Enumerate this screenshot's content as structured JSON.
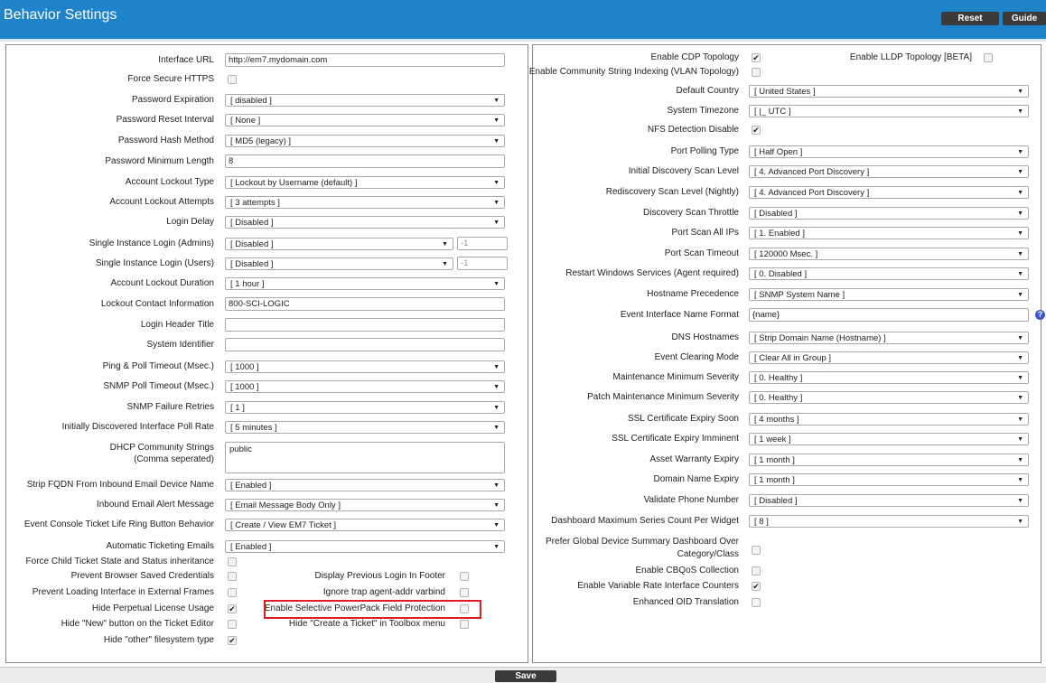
{
  "header": {
    "title": "Behavior Settings",
    "reset_label": "Reset",
    "guide_label": "Guide"
  },
  "left": {
    "interface_url": {
      "label": "Interface URL",
      "value": "http://em7.mydomain.com"
    },
    "force_secure_https": {
      "label": "Force Secure HTTPS"
    },
    "password_expiration": {
      "label": "Password Expiration",
      "value": "[ disabled ]"
    },
    "password_reset_interval": {
      "label": "Password Reset Interval",
      "value": "[ None ]"
    },
    "password_hash_method": {
      "label": "Password Hash Method",
      "value": "[ MD5 (legacy) ]"
    },
    "password_min_length": {
      "label": "Password Minimum Length",
      "value": "8"
    },
    "account_lockout_type": {
      "label": "Account Lockout Type",
      "value": "[ Lockout by Username (default) ]"
    },
    "account_lockout_attempts": {
      "label": "Account Lockout Attempts",
      "value": "[ 3 attempts ]"
    },
    "login_delay": {
      "label": "Login Delay",
      "value": "[ Disabled ]"
    },
    "single_login_admins": {
      "label": "Single Instance Login (Admins)",
      "value": "[ Disabled ]",
      "extra": "-1"
    },
    "single_login_users": {
      "label": "Single Instance Login (Users)",
      "value": "[ Disabled ]",
      "extra": "-1"
    },
    "account_lockout_duration": {
      "label": "Account Lockout Duration",
      "value": "[ 1 hour ]"
    },
    "lockout_contact": {
      "label": "Lockout Contact Information",
      "value": "800-SCI-LOGIC"
    },
    "login_header_title": {
      "label": "Login Header Title",
      "value": ""
    },
    "system_identifier": {
      "label": "System Identifier",
      "value": ""
    },
    "ping_poll_timeout": {
      "label": "Ping & Poll Timeout (Msec.)",
      "value": "[ 1000 ]"
    },
    "snmp_poll_timeout": {
      "label": "SNMP Poll Timeout (Msec.)",
      "value": "[ 1000 ]"
    },
    "snmp_failure_retries": {
      "label": "SNMP Failure Retries",
      "value": "[ 1 ]"
    },
    "interface_poll_rate": {
      "label": "Initially Discovered Interface Poll Rate",
      "value": "[ 5 minutes ]"
    },
    "dhcp_strings": {
      "label": "DHCP Community Strings",
      "label2": "(Comma seperated)",
      "value": "public"
    },
    "strip_fqdn": {
      "label": "Strip FQDN From Inbound Email Device Name",
      "value": "[ Enabled ]"
    },
    "inbound_email_msg": {
      "label": "Inbound Email Alert Message",
      "value": "[ Email Message Body Only ]"
    },
    "event_console_ring": {
      "label": "Event Console Ticket Life Ring Button Behavior",
      "value": "[ Create / View EM7 Ticket ]"
    },
    "auto_ticket_emails": {
      "label": "Automatic Ticketing Emails",
      "value": "[ Enabled ]"
    },
    "force_child_ticket": {
      "label": "Force Child Ticket State and Status inheritance"
    },
    "prevent_browser_creds": {
      "label": "Prevent Browser Saved Credentials"
    },
    "prevent_external_frames": {
      "label": "Prevent Loading Interface in External Frames"
    },
    "hide_perpetual": {
      "label": "Hide Perpetual License Usage"
    },
    "hide_new_button": {
      "label": "Hide \"New\" button on the Ticket Editor"
    },
    "hide_other_fs": {
      "label": "Hide \"other\" filesystem type"
    },
    "display_prev_login": {
      "label": "Display Previous Login In Footer"
    },
    "ignore_trap": {
      "label": "Ignore trap agent-addr varbind"
    },
    "selective_powerpack": {
      "label": "Enable Selective PowerPack Field Protection"
    },
    "hide_create_ticket": {
      "label": "Hide \"Create a Ticket\" in Toolbox menu"
    }
  },
  "right": {
    "cdp": {
      "label": "Enable CDP Topology"
    },
    "lldp": {
      "label": "Enable LLDP Topology [BETA]"
    },
    "community_indexing": {
      "label": "Enable Community String Indexing (VLAN Topology)"
    },
    "default_country": {
      "label": "Default Country",
      "value": "[ United States ]"
    },
    "system_timezone": {
      "label": "System Timezone",
      "value": "[ |_ UTC ]"
    },
    "nfs_detection": {
      "label": "NFS Detection Disable"
    },
    "port_polling_type": {
      "label": "Port Polling Type",
      "value": "[ Half Open ]"
    },
    "initial_scan_level": {
      "label": "Initial Discovery Scan Level",
      "value": "[ 4. Advanced Port Discovery ]"
    },
    "rediscovery_scan_level": {
      "label": "Rediscovery Scan Level (Nightly)",
      "value": "[ 4. Advanced Port Discovery ]"
    },
    "scan_throttle": {
      "label": "Discovery Scan Throttle",
      "value": "[ Disabled ]"
    },
    "port_scan_all": {
      "label": "Port Scan All IPs",
      "value": "[ 1. Enabled ]"
    },
    "port_scan_timeout": {
      "label": "Port Scan Timeout",
      "value": "[ 120000 Msec. ]"
    },
    "restart_windows": {
      "label": "Restart Windows Services (Agent required)",
      "value": "[ 0. Disabled ]"
    },
    "hostname_precedence": {
      "label": "Hostname Precedence",
      "value": "[ SNMP System Name ]"
    },
    "event_iface_format": {
      "label": "Event Interface Name Format",
      "value": "{name}"
    },
    "dns_hostnames": {
      "label": "DNS Hostnames",
      "value": "[ Strip Domain Name (Hostname) ]"
    },
    "event_clearing": {
      "label": "Event Clearing Mode",
      "value": "[ Clear All in Group ]"
    },
    "maint_min_sev": {
      "label": "Maintenance Minimum Severity",
      "value": "[ 0. Healthy ]"
    },
    "patch_maint_min_sev": {
      "label": "Patch Maintenance Minimum Severity",
      "value": "[ 0. Healthy ]"
    },
    "ssl_soon": {
      "label": "SSL Certificate Expiry Soon",
      "value": "[ 4 months ]"
    },
    "ssl_imminent": {
      "label": "SSL Certificate Expiry Imminent",
      "value": "[ 1 week ]"
    },
    "asset_warranty": {
      "label": "Asset Warranty Expiry",
      "value": "[ 1 month ]"
    },
    "domain_expiry": {
      "label": "Domain Name Expiry",
      "value": "[ 1 month ]"
    },
    "validate_phone": {
      "label": "Validate Phone Number",
      "value": "[ Disabled ]"
    },
    "dash_max_series": {
      "label": "Dashboard Maximum Series Count Per Widget",
      "value": "[ 8 ]"
    },
    "prefer_global_dash": {
      "label": "Prefer Global Device Summary Dashboard Over",
      "label2": "Category/Class"
    },
    "cbqos": {
      "label": "Enable CBQoS Collection"
    },
    "variable_rate": {
      "label": "Enable Variable Rate Interface Counters"
    },
    "enhanced_oid": {
      "label": "Enhanced OID Translation"
    }
  },
  "checkbox_states": {
    "force_secure_https": false,
    "force_child_ticket": false,
    "prevent_browser_creds": false,
    "prevent_external_frames": false,
    "hide_perpetual": true,
    "hide_new_button": false,
    "hide_other_fs": true,
    "display_prev_login": false,
    "ignore_trap": false,
    "selective_powerpack": false,
    "hide_create_ticket": false,
    "cdp": true,
    "lldp": false,
    "community_indexing": false,
    "nfs_detection": true,
    "prefer_global_dash": false,
    "cbqos": false,
    "variable_rate": true,
    "enhanced_oid": false
  },
  "icons": {
    "dropdown": "▼",
    "check": "✔",
    "help": "?"
  },
  "footer": {
    "save_label": "Save"
  },
  "colors": {
    "header_bg": "#1f83c9",
    "highlight": "#e01c24",
    "button_bg": "#3a3a3a"
  }
}
